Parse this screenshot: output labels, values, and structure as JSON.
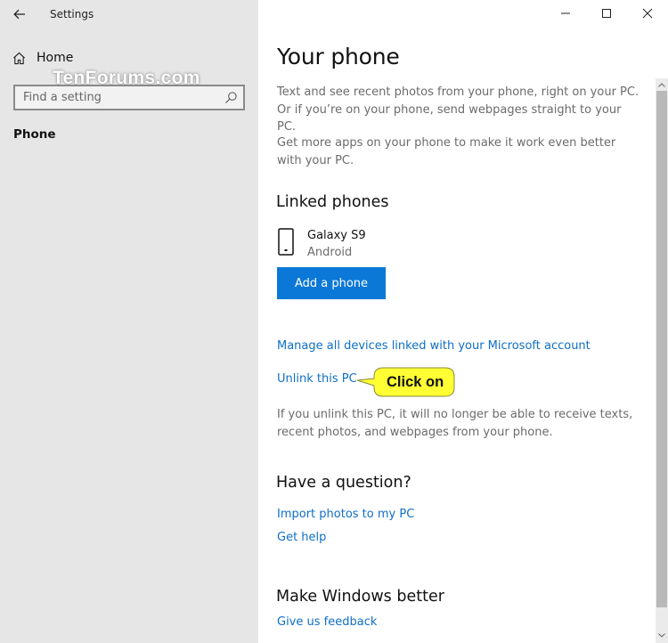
{
  "window": {
    "app_title": "Settings",
    "controls": {
      "minimize": "minimize-icon",
      "maximize": "maximize-icon",
      "close": "close-icon"
    }
  },
  "sidebar": {
    "back_icon": "back-arrow-icon",
    "home_label": "Home",
    "home_icon": "home-icon",
    "watermark": "TenForums.com",
    "search": {
      "placeholder": "Find a setting",
      "value": "",
      "icon": "search-icon"
    },
    "current_section": "Phone"
  },
  "main": {
    "title": "Your phone",
    "intro": "Text and see recent photos from your phone, right on your PC. Or if you’re on your phone, send webpages straight to your PC.",
    "more_apps": "Get more apps on your phone to make it work even better with your PC.",
    "linked_phones": {
      "heading": "Linked phones",
      "devices": [
        {
          "name": "Galaxy S9",
          "os": "Android",
          "icon": "phone-icon"
        }
      ],
      "add_button": "Add a phone"
    },
    "manage_link": "Manage all devices linked with your Microsoft account",
    "unlink_link": "Unlink this PC",
    "unlink_note": "If you unlink this PC, it will no longer be able to receive texts, recent photos, and webpages from your phone.",
    "question": {
      "heading": "Have a question?",
      "links": [
        "Import photos to my PC",
        "Get help"
      ]
    },
    "feedback": {
      "heading": "Make Windows better",
      "link": "Give us feedback"
    }
  },
  "annotation": {
    "callout_text": "Click on",
    "color": "#ffff33"
  },
  "colors": {
    "accent": "#0b78d7",
    "link": "#0f6fc6",
    "sidebar_bg": "#e6e6e6"
  }
}
